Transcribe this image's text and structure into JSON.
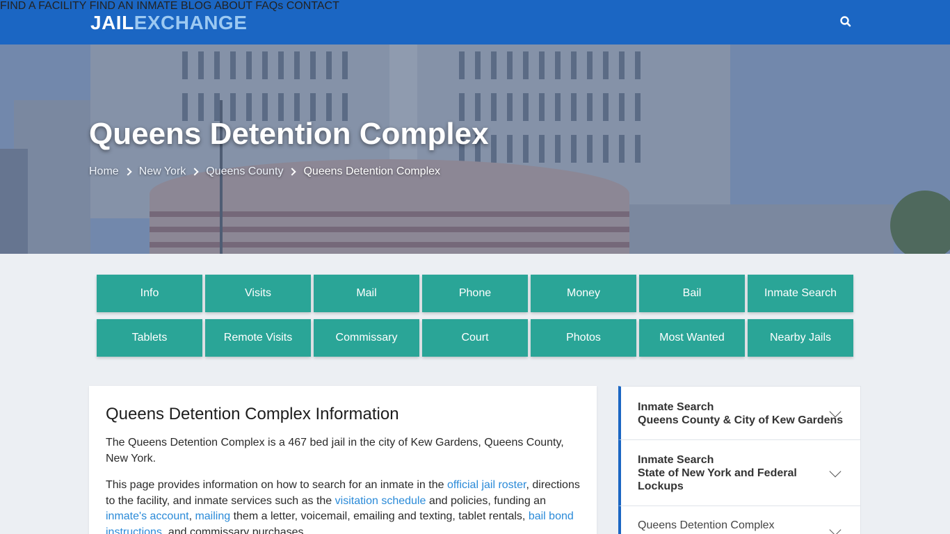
{
  "header": {
    "logo_part1": "JAIL",
    "logo_part2": "EXCHANGE",
    "nav": [
      "FIND A FACILITY",
      "FIND AN INMATE",
      "BLOG",
      "ABOUT",
      "FAQs",
      "CONTACT"
    ],
    "search_icon": "search-icon"
  },
  "hero": {
    "title": "Queens Detention Complex",
    "breadcrumb": [
      "Home",
      "New York",
      "Queens County",
      "Queens Detention Complex"
    ]
  },
  "buttons": {
    "row1": [
      "Info",
      "Visits",
      "Mail",
      "Phone",
      "Money",
      "Bail",
      "Inmate Search"
    ],
    "row2": [
      "Tablets",
      "Remote Visits",
      "Commissary",
      "Court",
      "Photos",
      "Most Wanted",
      "Nearby Jails"
    ]
  },
  "main": {
    "heading": "Queens Detention Complex Information",
    "para1": "The Queens Detention Complex is a 467 bed jail in the city of Kew Gardens, Queens County, New York.",
    "para2": {
      "t1": "This page provides information on how to search for an inmate in the ",
      "l1": "official jail roster",
      "t2": ", directions to the facility, and inmate services such as the ",
      "l2": "visitation schedule",
      "t3": " and policies, funding an ",
      "l3": "inmate's account",
      "t4": ", ",
      "l4": "mailing",
      "t5": " them a letter, voicemail, emailing and texting, tablet rentals, ",
      "l5": "bail bond instructions",
      "t6": ", and commissary purchases."
    }
  },
  "sidebar": {
    "items": [
      {
        "line1": "Inmate Search",
        "line2": "Queens County & City of Kew Gardens"
      },
      {
        "line1": "Inmate Search",
        "line2": "State of New York and Federal",
        "line3": "Lockups"
      },
      {
        "line1": "Queens Detention Complex"
      }
    ]
  },
  "colors": {
    "header_bg": "#1b66c3",
    "logo_accent": "#9cc9f2",
    "button_bg": "#2aa597",
    "link": "#2a8ad8",
    "page_bg": "#eceff3"
  }
}
